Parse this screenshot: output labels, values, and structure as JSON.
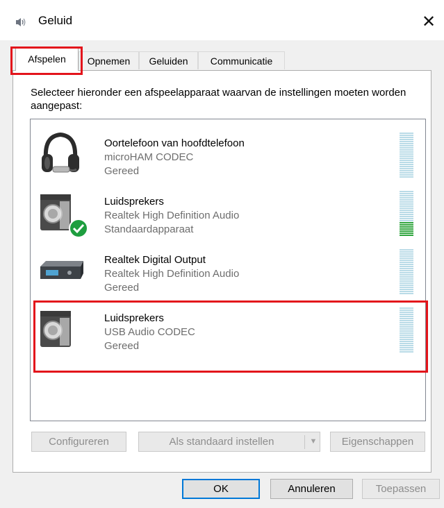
{
  "window": {
    "title": "Geluid",
    "close_glyph": "✕",
    "app_icon": "speaker-icon"
  },
  "tabs": [
    {
      "label": "Afspelen",
      "active": true
    },
    {
      "label": "Opnemen",
      "active": false
    },
    {
      "label": "Geluiden",
      "active": false
    },
    {
      "label": "Communicatie",
      "active": false
    }
  ],
  "instruction": "Selecteer hieronder een afspeelapparaat waarvan de instellingen moeten worden aangepast:",
  "devices": [
    {
      "name": "Oortelefoon van hoofdtelefoon",
      "driver": "microHAM CODEC",
      "status": "Gereed",
      "icon": "headphones-icon",
      "default": false,
      "level_fraction": 0.0
    },
    {
      "name": "Luidsprekers",
      "driver": "Realtek High Definition Audio",
      "status": "Standaardapparaat",
      "icon": "speaker-icon",
      "default": true,
      "level_fraction": 0.3
    },
    {
      "name": "Realtek Digital Output",
      "driver": "Realtek High Definition Audio",
      "status": "Gereed",
      "icon": "digital-output-icon",
      "default": false,
      "level_fraction": 0.0
    },
    {
      "name": "Luidsprekers",
      "driver": "USB Audio CODEC",
      "status": "Gereed",
      "icon": "speaker-icon",
      "default": false,
      "level_fraction": 0.0
    }
  ],
  "buttons": {
    "configure": "Configureren",
    "set_default": "Als standaard instellen",
    "properties": "Eigenschappen",
    "ok": "OK",
    "cancel": "Annuleren",
    "apply": "Toepassen"
  },
  "colors": {
    "highlight": "#e3141b",
    "meter_idle": "#b9dbe7",
    "meter_active": "#2fa43d",
    "default_check": "#1e9e3f",
    "focus_border": "#0078d7"
  }
}
